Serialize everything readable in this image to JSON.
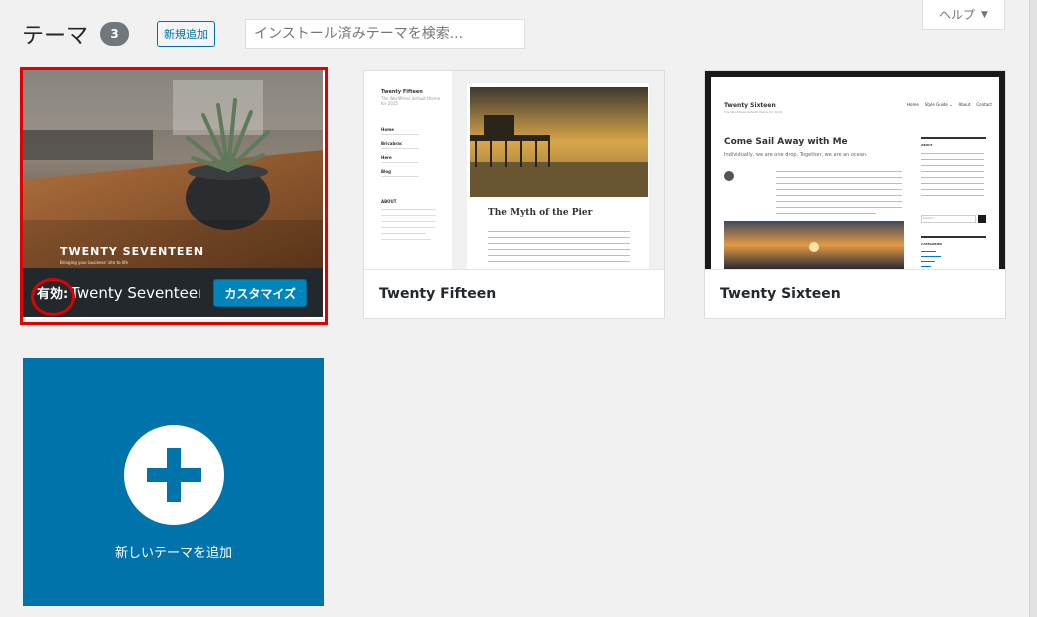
{
  "header": {
    "title": "テーマ",
    "count": "3",
    "add_new_label": "新規追加",
    "search_placeholder": "インストール済みテーマを検索..."
  },
  "help": {
    "label": "ヘルプ",
    "arrow": "▼"
  },
  "themes": [
    {
      "name": "Twenty Seventeen",
      "active_label": "有効:",
      "customize_label": "カスタマイズ",
      "screenshot": {
        "title": "TWENTY SEVENTEEN",
        "tagline": "Bringing your business' site to life"
      }
    },
    {
      "name": "Twenty Fifteen",
      "screenshot": {
        "site_title": "Twenty Fifteen",
        "site_desc": "The WordPress default theme for 2015",
        "menu": [
          "Home",
          "Bricabrac",
          "Here",
          "Blog"
        ],
        "about": "ABOUT",
        "post_title": "The Myth of the Pier"
      }
    },
    {
      "name": "Twenty Sixteen",
      "screenshot": {
        "site_title": "Twenty Sixteen",
        "site_desc": "The WordPress default theme for 2016",
        "nav": [
          "Home",
          "Style Guide ⌄",
          "About",
          "Contact"
        ],
        "post_title": "Come Sail Away with Me",
        "post_subtitle": "Individually, we are one drop. Together, we are an ocean.",
        "widget_about": "ABOUT",
        "widget_categories": "CATEGORIES",
        "search_placeholder": "Search..."
      }
    }
  ],
  "add_new_theme": {
    "label": "新しいテーマを追加"
  },
  "colors": {
    "accent": "#0073aa",
    "highlight": "#e00000",
    "active_bar": "#23282d"
  }
}
